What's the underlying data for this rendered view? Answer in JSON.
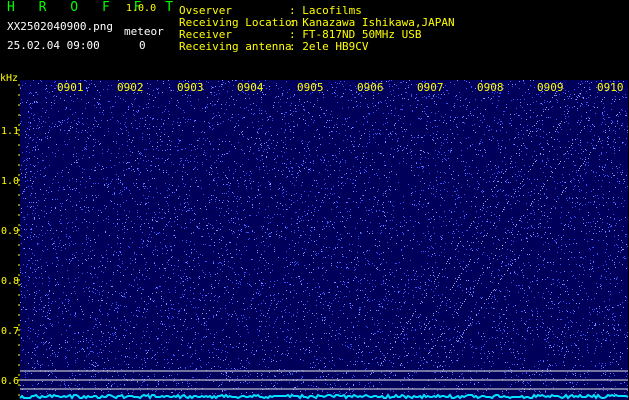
{
  "header": {
    "app_name": "H R O F F T",
    "version": "1.0.0",
    "file_name": "XX2502040900.png",
    "timestamp": "25.02.04 09:00",
    "meteor_label": "meteor",
    "meteor_count": "0"
  },
  "station_info": [
    {
      "key": "Ovserver",
      "value": ": Lacofilms"
    },
    {
      "key": "Receiving Location",
      "value": ": Kanazawa Ishikawa,JAPAN"
    },
    {
      "key": "Receiver",
      "value": ": FT-817ND 50MHz USB"
    },
    {
      "key": "Receiving antenna",
      "value": ": 2ele HB9CV"
    }
  ],
  "spectrogram": {
    "freq_unit": "kHz",
    "time_ticks": [
      "0901",
      "0902",
      "0903",
      "0904",
      "0905",
      "0906",
      "0907",
      "0908",
      "0909",
      "0910"
    ],
    "freq_ticks": [
      "1.1",
      "1.0",
      "0.9",
      "0.8",
      "0.7",
      "0.6"
    ],
    "colors": {
      "background": "#00005a",
      "noise": "#3a52ff",
      "trace": "#cfd8ff",
      "baseline": "#00e0ff",
      "text": "#ffff00"
    }
  }
}
